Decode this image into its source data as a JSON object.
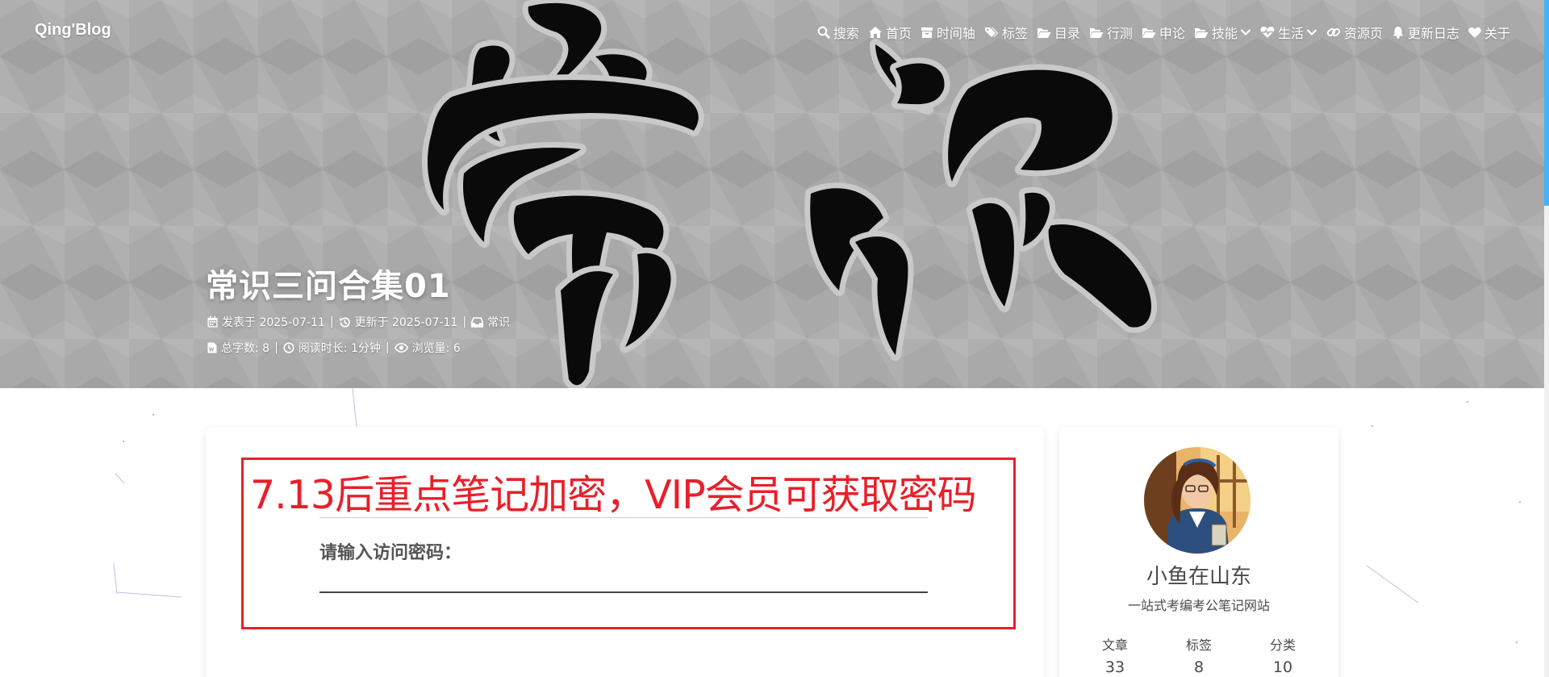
{
  "site": {
    "logo": "Qing'Blog"
  },
  "nav": {
    "items": [
      {
        "label": "搜索",
        "icon": "search-icon"
      },
      {
        "label": "首页",
        "icon": "home-icon"
      },
      {
        "label": "时间轴",
        "icon": "archive-icon"
      },
      {
        "label": "标签",
        "icon": "tags-icon"
      },
      {
        "label": "目录",
        "icon": "folder-open-icon"
      },
      {
        "label": "行测",
        "icon": "folder-open-icon"
      },
      {
        "label": "申论",
        "icon": "folder-open-icon"
      },
      {
        "label": "技能",
        "icon": "folder-open-icon",
        "dropdown": true
      },
      {
        "label": "生活",
        "icon": "heartbeat-icon",
        "dropdown": true
      },
      {
        "label": "资源页",
        "icon": "link-icon"
      },
      {
        "label": "更新日志",
        "icon": "bell-icon"
      },
      {
        "label": "关于",
        "icon": "heart-icon"
      }
    ]
  },
  "post": {
    "title": "常识三问合集01",
    "meta": {
      "published": "发表于 2025-07-11",
      "updated": "更新于 2025-07-11",
      "category": "常识",
      "word_count": "总字数: 8",
      "read_time": "阅读时长: 1分钟",
      "views": "浏览量: 6",
      "separator": "|"
    }
  },
  "content": {
    "notice": "7.13后重点笔记加密，VIP会员可获取密码",
    "password_label": "请输入访问密码：",
    "password_value": ""
  },
  "sidebar": {
    "author_name": "小鱼在山东",
    "author_desc": "一站式考编考公笔记网站",
    "stats": [
      {
        "label": "文章",
        "value": "33"
      },
      {
        "label": "标签",
        "value": "8"
      },
      {
        "label": "分类",
        "value": "10"
      }
    ]
  },
  "colors": {
    "accent_red": "#e8202a",
    "hero_bg": "#a9a9a9",
    "text": "#4c4948",
    "scroll_thumb": "#49b1f5"
  }
}
